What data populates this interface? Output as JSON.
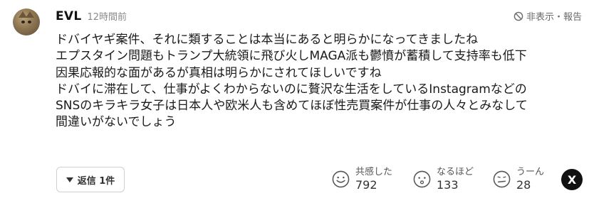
{
  "comment": {
    "username": "EVL",
    "time": "12時間前",
    "report_label": "非表示・報告",
    "lines": [
      "ドバイヤギ案件、それに類することは本当にあると明らかになってきましたね",
      "エプスタイン問題もトランプ大統領に飛び火しMAGA派も鬱憤が蓄積して支持率も低下",
      "因果応報的な面があるが真相は明らかにされてほしいですね",
      "ドバイに滞在して、仕事がよくわからないのに贅沢な生活をしているInstagramなどの",
      "SNSのキラキラ女子は日本人や欧米人も含めてほぼ性売買案件が仕事の人々とみなして",
      "間違いがないでしょう"
    ]
  },
  "actions": {
    "reply_label": "返信 1件",
    "reactions": [
      {
        "label": "共感した",
        "count": "792",
        "icon": "smile-face-icon"
      },
      {
        "label": "なるほど",
        "count": "133",
        "icon": "thinking-face-icon"
      },
      {
        "label": "うーん",
        "count": "28",
        "icon": "hmm-face-icon"
      }
    ],
    "share_label": "X"
  }
}
